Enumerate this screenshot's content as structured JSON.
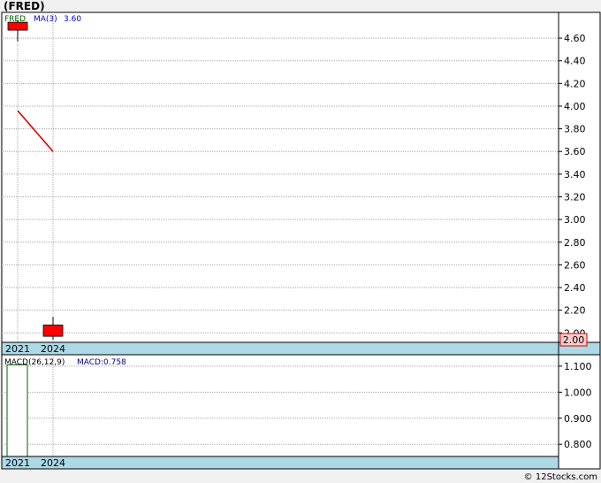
{
  "title": "(FRED)",
  "footer": "© 12Stocks.com",
  "colors": {
    "background": "#ffffff",
    "grid": "#aaaaaa",
    "candle": "#ff0000",
    "ma_line": "#e00000",
    "date_band": "#add8e6",
    "macd_bar_stroke": "#006400",
    "last_price_box": "#ffcccc",
    "legend_ticker": "#006400",
    "legend_ma": "#0000cc",
    "legend_macd": "#000080"
  },
  "chart_data": [
    {
      "type": "candlestick",
      "ticker": "FRED",
      "legend": {
        "ticker": "FRED",
        "ma_label": "MA(3)",
        "ma_value": "3.60"
      },
      "x_labels": [
        "2021",
        "2024"
      ],
      "y_ticks": [
        "4.60",
        "4.40",
        "4.20",
        "4.00",
        "3.80",
        "3.60",
        "3.40",
        "3.20",
        "3.00",
        "2.80",
        "2.60",
        "2.40",
        "2.20",
        "2.00"
      ],
      "ylim": [
        1.94,
        4.78
      ],
      "candles": [
        {
          "x": "2021",
          "open": 4.74,
          "close": 4.67,
          "high": 4.76,
          "low": 4.57
        },
        {
          "x": "2024",
          "open": 2.07,
          "close": 1.97,
          "high": 2.14,
          "low": 1.94
        }
      ],
      "ma_line": [
        {
          "x": "2021",
          "y": 3.96
        },
        {
          "x": "2024",
          "y": 3.6
        }
      ],
      "last_price": "2.00",
      "grid": true
    },
    {
      "type": "bar",
      "legend": {
        "label": "MACD(26,12,9)",
        "value_label": "MACD:0.758"
      },
      "x_labels": [
        "2021",
        "2024"
      ],
      "y_ticks": [
        "1.100",
        "1.000",
        "0.900",
        "0.800"
      ],
      "ylim": [
        0.76,
        1.12
      ],
      "bars": [
        {
          "x": "2021",
          "value": 1.105
        }
      ],
      "grid": true
    }
  ]
}
